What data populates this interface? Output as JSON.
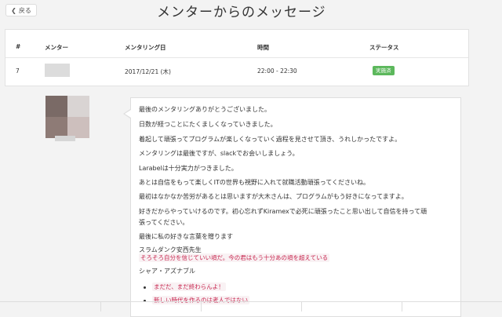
{
  "header": {
    "back_label": "戻る",
    "title": "メンターからのメッセージ"
  },
  "table": {
    "columns": [
      "#",
      "メンター",
      "メンタリング日",
      "時間",
      "ステータス"
    ],
    "row": {
      "id": "7",
      "date": "2017/12/21 (木)",
      "time": "22:00 - 22:30",
      "status": "実施済",
      "status_color": "#5cb85c"
    }
  },
  "message": {
    "lines": [
      "最後のメンタリングありがとうございました。",
      "日数が経つことにたくましくなっていきました。",
      "着起して頑張ってプログラムが楽しくなっていく過程を見させて頂き、うれしかったですよ。",
      "メンタリングは最後ですが、slackでお会いしましょう。",
      "Larabelは十分実力がつきました。",
      "あとは自信をもって楽しくITの世界も視野に入れて就職活動頑張ってくださいね。",
      "最初はなかなか苦労があるとは思いますが大木さんは、プログラムがもう好きになってますよ。",
      "好きだからやっていけるのです。初心忘れずKiramexで必死に頑張ったこと思い出して自信を持って頑",
      "張ってください。",
      "最後に私の好きな言葉を贈ります",
      "スラムダンク安西先生"
    ],
    "quote1": "そろそろ自分を信じていい頃だ。今の君はもう十分あの頃を超えている",
    "author2": "シャア・アズナブル",
    "bullets": [
      "まだだ、まだ終わらんよ！",
      "新しい時代を作るのは老人ではない"
    ]
  },
  "colors": {
    "accent_green": "#5cb85c",
    "code_red": "#c7254e"
  }
}
